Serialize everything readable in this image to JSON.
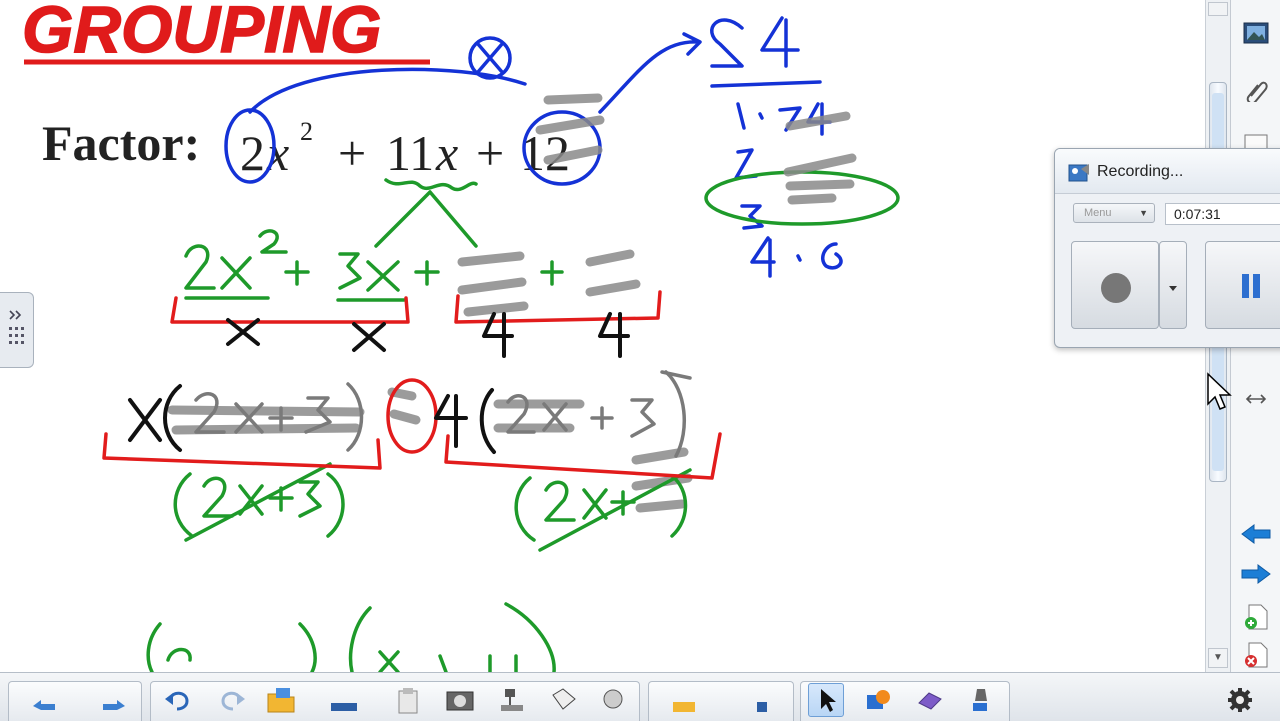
{
  "board": {
    "title": "GROUPING",
    "factor_label": "Factor:",
    "expression": {
      "a_coef": "2",
      "var1": "x",
      "exp": "2",
      "plus1": "+",
      "b_coef": "11",
      "var2": "x",
      "plus2": "+",
      "c_const": "12"
    }
  },
  "recorder": {
    "title": "Recording...",
    "menu_label": "Menu",
    "elapsed_time": "0:07:31"
  },
  "side_tabs": [
    "gallery-icon",
    "attachments-icon",
    "properties-icon"
  ],
  "toolbar": {
    "tools": [
      "previous-page-icon",
      "next-page-icon",
      "screen-shade-icon",
      "undo-icon",
      "redo-icon",
      "open-file-icon",
      "paste-icon",
      "screen-capture-icon",
      "document-camera-icon",
      "table-icon",
      "fill-icon",
      "select-icon",
      "pen-icon",
      "eraser-icon",
      "shapes-icon",
      "settings-icon"
    ]
  },
  "colors": {
    "title_red": "#e01b1b",
    "ink_blue": "#1432d6",
    "ink_green": "#1e9a2a",
    "ink_red": "#e21c1c",
    "ink_gray": "#8a8a8a",
    "ink_black": "#111111"
  }
}
